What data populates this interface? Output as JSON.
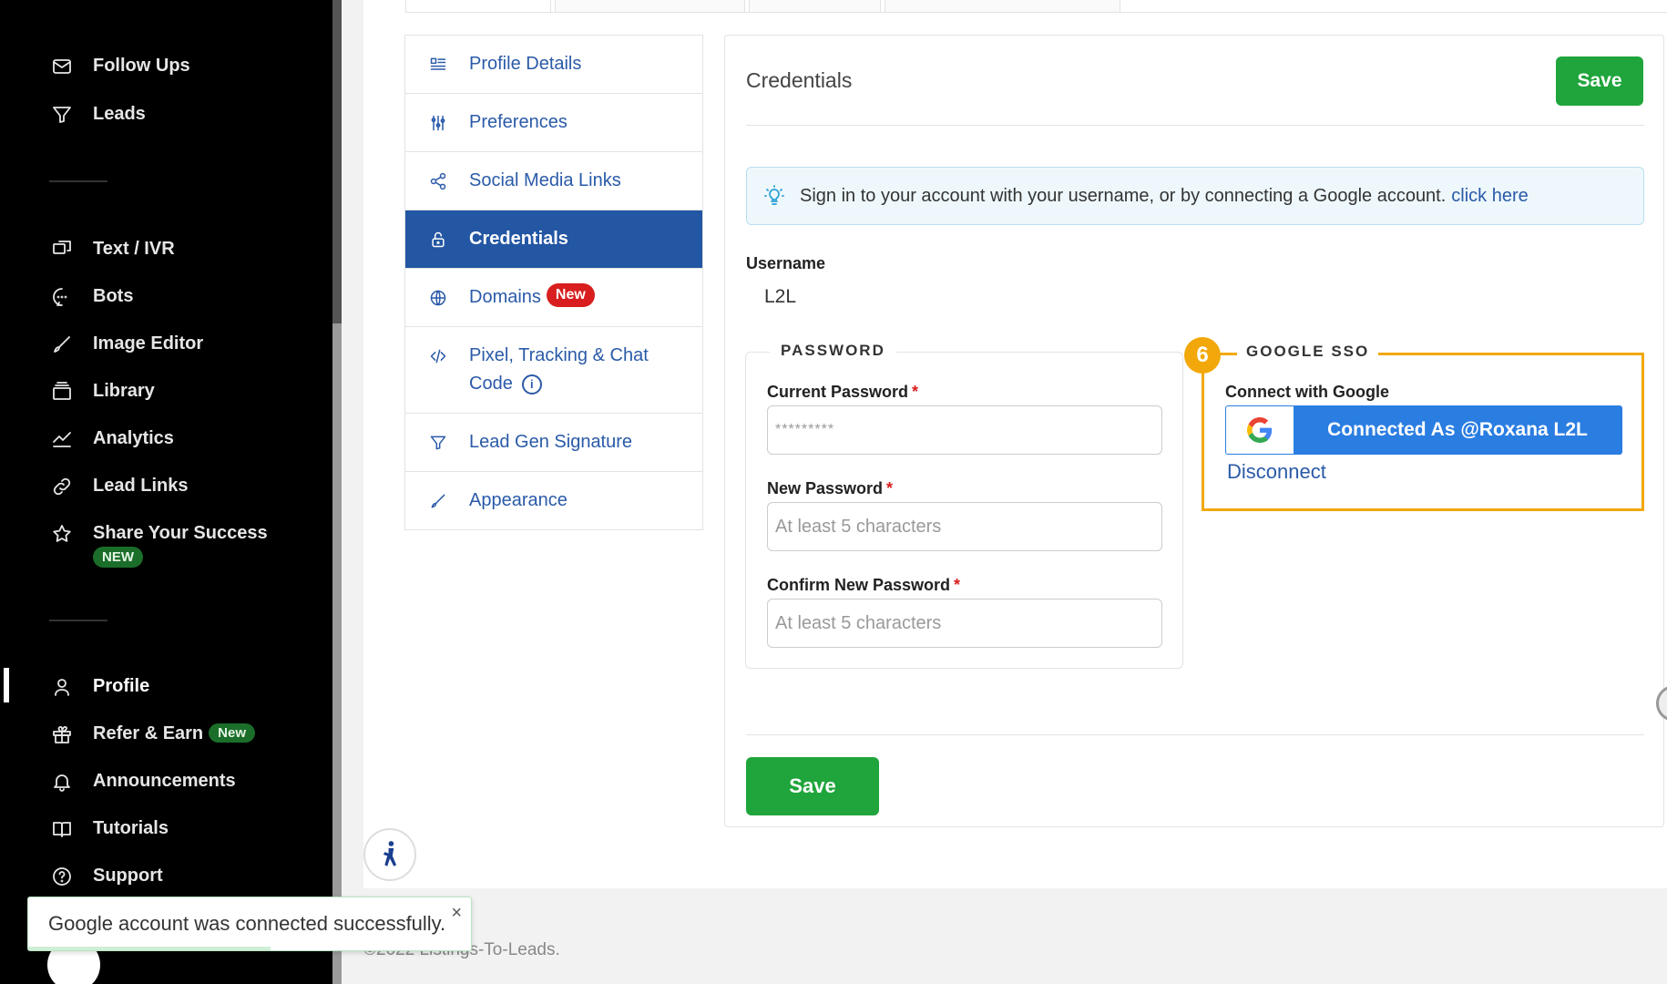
{
  "sidebar": {
    "items": [
      {
        "label": "Follow Ups",
        "icon": "mail-icon"
      },
      {
        "label": "Leads",
        "icon": "filter-icon"
      },
      {
        "label": "Text / IVR",
        "icon": "chat-icon"
      },
      {
        "label": "Bots",
        "icon": "bot-chat-icon"
      },
      {
        "label": "Image Editor",
        "icon": "brush-icon"
      },
      {
        "label": "Library",
        "icon": "library-icon"
      },
      {
        "label": "Analytics",
        "icon": "analytics-icon"
      },
      {
        "label": "Lead Links",
        "icon": "link-icon"
      },
      {
        "label": "Share Your Success",
        "icon": "star-icon",
        "badge": "NEW"
      },
      {
        "label": "Profile",
        "icon": "user-icon"
      },
      {
        "label": "Refer & Earn",
        "icon": "gift-icon",
        "badge": "New"
      },
      {
        "label": "Announcements",
        "icon": "bell-icon"
      },
      {
        "label": "Tutorials",
        "icon": "book-icon"
      },
      {
        "label": "Support",
        "icon": "help-icon"
      }
    ]
  },
  "settings_menu": {
    "items": [
      {
        "label": "Profile Details"
      },
      {
        "label": "Preferences"
      },
      {
        "label": "Social Media Links"
      },
      {
        "label": "Credentials"
      },
      {
        "label": "Domains",
        "badge": "New"
      },
      {
        "label": "Pixel, Tracking & Chat",
        "label2": "Code"
      },
      {
        "label": "Lead Gen Signature"
      },
      {
        "label": "Appearance"
      }
    ]
  },
  "card": {
    "title": "Credentials",
    "save_label": "Save",
    "info_text": "Sign in to your account with your username, or by connecting a Google account.",
    "info_link": "click here",
    "username_label": "Username",
    "username_value": "L2L",
    "password": {
      "legend": "PASSWORD",
      "current_label": "Current Password",
      "current_value": "*********",
      "new_label": "New Password",
      "new_placeholder": "At least 5 characters",
      "confirm_label": "Confirm New Password",
      "confirm_placeholder": "At least 5 characters",
      "required_mark": "*"
    },
    "google_sso": {
      "legend": "GOOGLE SSO",
      "step": "6",
      "connect_label": "Connect with Google",
      "button_label": "Connected As @Roxana L2L",
      "disconnect_label": "Disconnect"
    }
  },
  "footer": {
    "text": "©2022 Listings-To-Leads."
  },
  "toast": {
    "message": "Google account was connected successfully.",
    "close": "×"
  },
  "colors": {
    "accent": "#2356a3",
    "save_green": "#1fa53b",
    "highlight": "#f2a80a",
    "badge_red": "#d81e1e"
  }
}
